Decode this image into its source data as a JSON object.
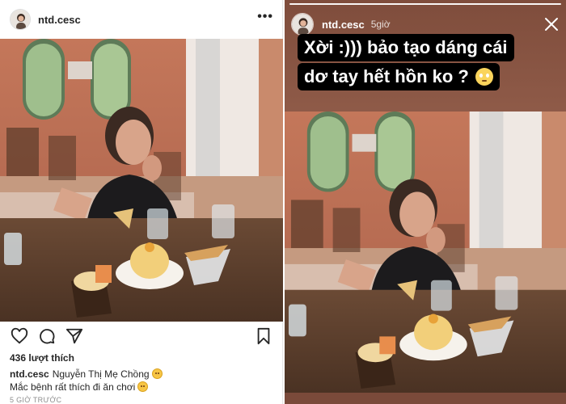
{
  "post": {
    "username": "ntd.cesc",
    "more_label": "•••",
    "likes": "436 lượt thích",
    "caption_user": "ntd.cesc",
    "caption_text": "Nguyễn Thị Mẹ Chồng",
    "caption_line2": "Mắc bệnh rất thích đi ăn chơi",
    "time": "5 GIỜ TRƯỚC",
    "icons": [
      "heart-icon",
      "comment-icon",
      "share-icon",
      "bookmark-icon"
    ]
  },
  "story": {
    "username": "ntd.cesc",
    "time": "5giờ",
    "text_line1": "Xời :))) bảo tạo dáng cái",
    "text_line2": "dơ tay hết hồn ko ?",
    "icons": [
      "close-icon",
      "flushed-face-emoji"
    ]
  },
  "colors": {
    "text": "#262626",
    "muted": "#8e8e8e",
    "story_bg": "#8a5a4a",
    "text_bg": "#000000"
  }
}
